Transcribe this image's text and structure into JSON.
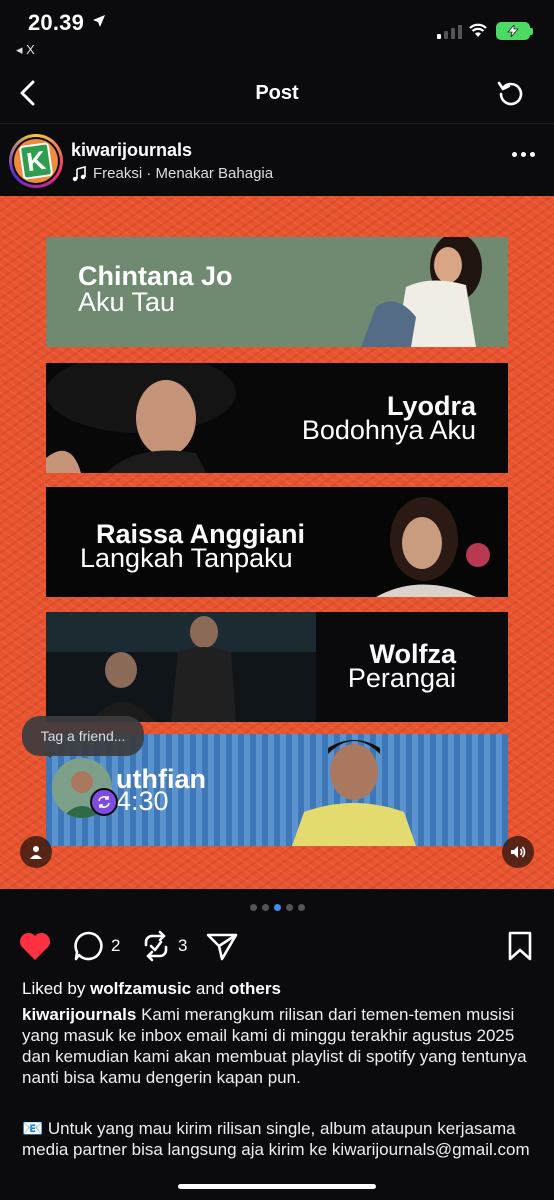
{
  "status_bar": {
    "time": "20.39",
    "back_app": "◂ X"
  },
  "nav": {
    "title": "Post"
  },
  "post": {
    "username": "kiwarijournals",
    "music": "Freaksi · Menakar Bahagia",
    "avatar_letter": "K"
  },
  "media": {
    "cards": [
      {
        "line1": "Chintana Jo",
        "line2": "Aku Tau"
      },
      {
        "line1": "Lyodra",
        "line2": "Bodohnya Aku"
      },
      {
        "line1": "Raissa Anggiani",
        "line2": "Langkah Tanpaku"
      },
      {
        "line1": "Wolfza",
        "line2": "Perangai"
      },
      {
        "line1": "uthfian",
        "line2": "4:30"
      }
    ],
    "tag_prompt": "Tag a friend..."
  },
  "carousel": {
    "total": 5,
    "active_index": 2
  },
  "actions": {
    "comments": "2",
    "reposts": "3",
    "liked": true
  },
  "likes": {
    "prefix": "Liked by",
    "user": "wolfzamusic",
    "mid": "and",
    "suffix": "others"
  },
  "caption": {
    "user": "kiwarijournals",
    "text": "Kami merangkum rilisan dari temen-temen musisi yang masuk ke inbox email kami di minggu terakhir agustus 2025 dan kemudian kami akan membuat playlist di spotify yang tentunya nanti bisa kamu dengerin kapan pun.",
    "text2": "📧  Untuk yang mau kirim rilisan single, album ataupun kerjasama media partner bisa langsung aja kirim ke kiwarijournals@gmail.com"
  },
  "colors": {
    "accent": "#3d8df5",
    "like": "#ff3040",
    "media_bg": "#e9532e",
    "battery": "#4cd964"
  }
}
